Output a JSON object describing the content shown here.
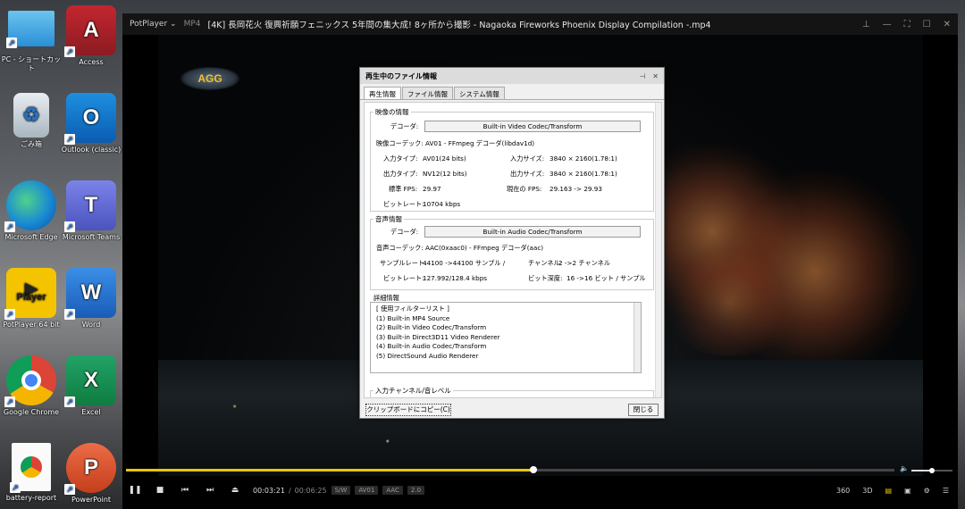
{
  "desktop": {
    "icons": [
      {
        "label": "PC - ショートカット"
      },
      {
        "label": "Access"
      },
      {
        "label": "ごみ箱"
      },
      {
        "label": "Outlook (classic)"
      },
      {
        "label": "Microsoft Edge"
      },
      {
        "label": "Microsoft Teams"
      },
      {
        "label": "PotPlayer 64 bit"
      },
      {
        "label": "Word"
      },
      {
        "label": "Google Chrome"
      },
      {
        "label": "Excel"
      },
      {
        "label": "battery-report"
      },
      {
        "label": "PowerPoint"
      }
    ],
    "glyphs": {
      "access": "A",
      "outlook": "O",
      "teams": "T",
      "potplayer": "Player",
      "word": "W",
      "excel": "X",
      "powerpoint": "P"
    }
  },
  "player": {
    "app_name": "PotPlayer",
    "app_menu_icon": "chevron-down-icon",
    "format": "MP4",
    "title": "[4K] 長岡花火 復興祈願フェニックス 5年間の集大成! 8ヶ所から撮影 - Nagaoka Fireworks Phoenix Display Compilation -.mp4",
    "logo_text": "AGG",
    "progress": 0.53,
    "volume": 0.5,
    "time_current": "00:03:21",
    "time_sep": "/",
    "time_total": "00:06:25",
    "tags": [
      "S/W",
      "AV01",
      "AAC",
      "2.0"
    ],
    "right_controls": [
      "360",
      "3D"
    ]
  },
  "dialog": {
    "title": "再生中のファイル情報",
    "tabs": [
      "再生情報",
      "ファイル情報",
      "システム情報"
    ],
    "video": {
      "group_title": "映像の情報",
      "decoder_label": "デコーダ:",
      "decoder_value": "Built-in Video Codec/Transform",
      "codec_line": "映像コーデック: AV01 - FFmpeg デコーダ(libdav1d)",
      "input_type_label": "入力タイプ:",
      "input_type_value": "AV01(24 bits)",
      "input_size_label": "入力サイズ:",
      "input_size_value": "3840 × 2160(1.78:1)",
      "output_type_label": "出力タイプ:",
      "output_type_value": "NV12(12 bits)",
      "output_size_label": "出力サイズ:",
      "output_size_value": "3840 × 2160(1.78:1)",
      "std_fps_label": "標準 FPS:",
      "std_fps_value": "29.97",
      "cur_fps_label": "現在の FPS:",
      "cur_fps_value": "29.163 -> 29.93",
      "bitrate_label": "ビットレート:",
      "bitrate_value": "10704 kbps"
    },
    "audio": {
      "group_title": "音声情報",
      "decoder_label": "デコーダ:",
      "decoder_value": "Built-in Audio Codec/Transform",
      "codec_line": "音声コーデック: AAC(0xaac0) - FFmpeg デコーダ(aac)",
      "sample_label": "サンプルレート:",
      "sample_value": "44100 ->44100 サンプル /",
      "channel_label": "チャンネル:",
      "channel_value": "2 ->2 チャンネル",
      "bitrate_label": "ビットレート:",
      "bitrate_value": "127.992/128.4 kbps",
      "depth_label": "ビット深度:",
      "depth_value": "16 ->16 ビット / サンプル"
    },
    "detail": {
      "group_title": "詳細情報",
      "lines": [
        "[ 使用フィルターリスト ]",
        "(1) Built-in MP4 Source",
        "(2) Built-in Video Codec/Transform",
        "(3) Built-in Direct3D11 Video Renderer",
        "(4) Built-in Audio Codec/Transform",
        "(5) DirectSound Audio Renderer"
      ]
    },
    "channel_group_title": "入力チャンネル/音レベル",
    "copy_button": "クリップボードにコピー(C)",
    "close_button": "閉じる"
  }
}
